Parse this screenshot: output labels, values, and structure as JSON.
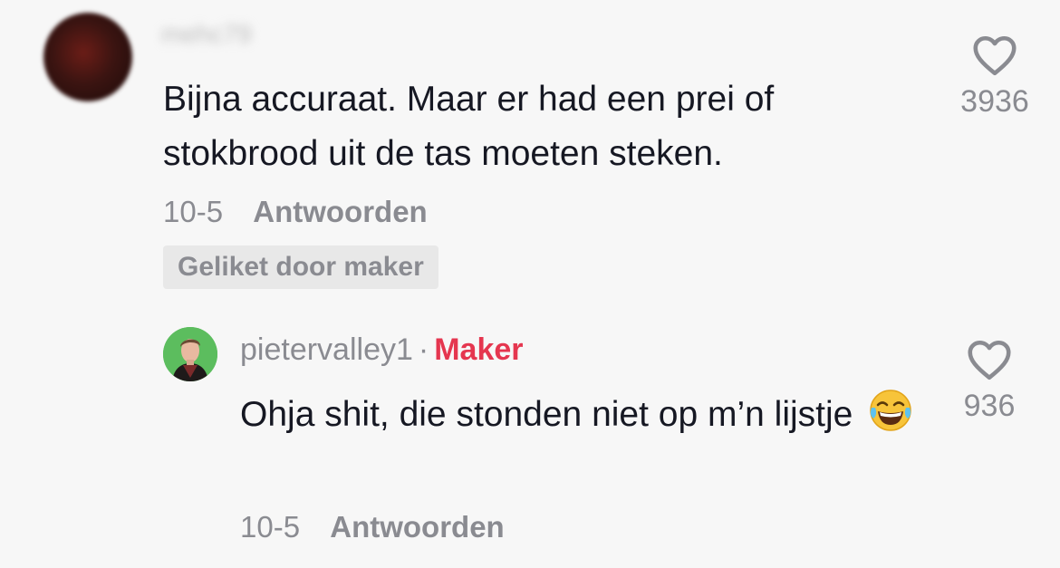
{
  "comment": {
    "username": "mehc79",
    "text": "Bijna accuraat. Maar er had een prei of stokbrood uit de tas moeten steken.",
    "date": "10-5",
    "reply_label": "Antwoorden",
    "liked_badge": "Geliket door maker",
    "likes": "3936"
  },
  "reply": {
    "username": "pietervalley1",
    "separator": "·",
    "role_badge": "Maker",
    "text": "Ohja shit, die stonden niet op m’n lijstje",
    "emoji": "face-with-tears-of-joy",
    "date": "10-5",
    "reply_label": "Antwoorden",
    "likes": "936"
  },
  "colors": {
    "background": "#f7f7f7",
    "text_primary": "#161823",
    "text_secondary": "#8a8b91",
    "maker_accent": "#e5364f",
    "badge_bg": "#e8e8e8"
  },
  "icons": [
    "heart-outline-icon",
    "face-with-tears-of-joy-emoji"
  ]
}
